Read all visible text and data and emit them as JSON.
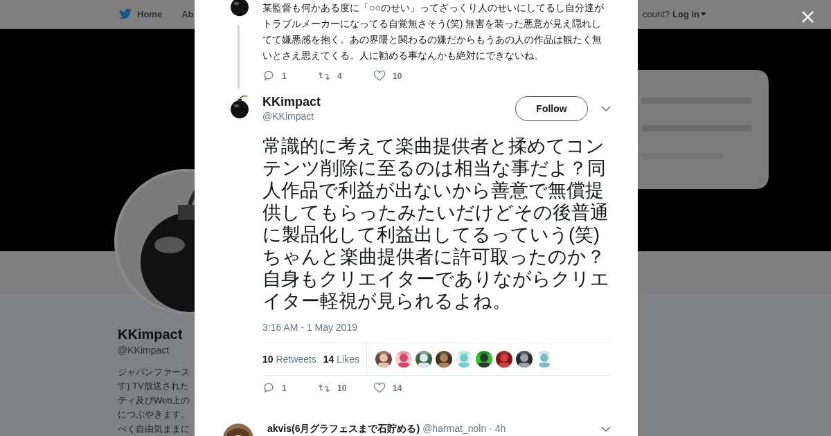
{
  "background_page": {
    "nav": {
      "items": [
        {
          "label": "Home",
          "kind": "home"
        },
        {
          "label": "Ab",
          "kind": "plain"
        }
      ],
      "account_prompt": "count?",
      "login": "Log in"
    },
    "profile": {
      "name": "KKimpact",
      "handle": "@KKimpact",
      "bio_lines": [
        "ジャパンファース",
        "す) TV放送された",
        "ティ及びWeb上の",
        "につぶやきます。",
        "べく自由気ままに"
      ]
    }
  },
  "modal": {
    "previous_tweet": {
      "text": "某監督も何かある度に「○○のせい」ってざっくり人のせいにしてるし自分達がトラブルメーカーになってる自覚無さそう(笑) 無害を装った悪意が見え隠れしてて嫌悪感を抱く。あの界隈と関わるの嫌だからもうあの人の作品は観たく無いとさえ思えてくる。人に勧める事なんかも絶対にできないね。",
      "actions": [
        {
          "kind": "reply",
          "count": "1"
        },
        {
          "kind": "retweet",
          "count": "4"
        },
        {
          "kind": "like",
          "count": "10"
        }
      ]
    },
    "tweet": {
      "name": "KKimpact",
      "handle": "@KKimpact",
      "follow_button": "Follow",
      "text": "常識的に考えて楽曲提供者と揉めてコンテンツ削除に至るのは相当な事だよ？同人作品で利益が出ないから善意で無償提供してもらったみたいだけどその後普通に製品化して利益出してるっていう(笑) ちゃんと楽曲提供者に許可取ったのか？自身もクリエイターでありながらクリエイター軽視が見られるよね。",
      "timestamp": "3:16 AM - 1 May 2019",
      "stats": [
        {
          "count": "10",
          "label": "Retweets"
        },
        {
          "count": "14",
          "label": "Likes"
        }
      ],
      "actions": [
        {
          "kind": "reply",
          "count": "1"
        },
        {
          "kind": "retweet",
          "count": "10"
        },
        {
          "kind": "like",
          "count": "14"
        }
      ]
    },
    "reply": {
      "name": "akvis(6月グラフェスまで石貯める)",
      "meta": "@harmat_noln · 4h"
    }
  }
}
